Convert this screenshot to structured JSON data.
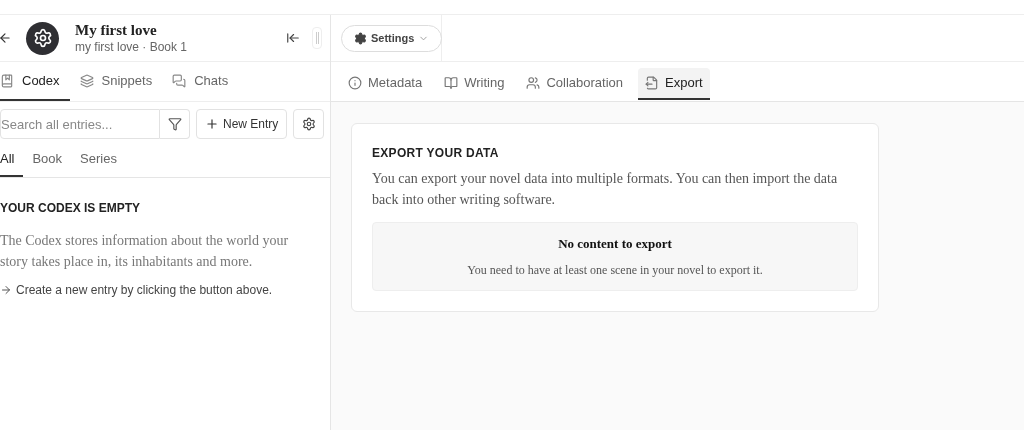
{
  "project": {
    "title": "My first love",
    "subtitle": "my first love · Book 1"
  },
  "settings_button": {
    "label": "Settings"
  },
  "sidebar_tabs": [
    {
      "label": "Codex",
      "selected": true
    },
    {
      "label": "Snippets",
      "selected": false
    },
    {
      "label": "Chats",
      "selected": false
    }
  ],
  "search": {
    "placeholder": "Search all entries..."
  },
  "new_entry_button": {
    "label": "New Entry"
  },
  "filter_tabs": [
    {
      "label": "All",
      "selected": true
    },
    {
      "label": "Book",
      "selected": false
    },
    {
      "label": "Series",
      "selected": false
    }
  ],
  "codex_empty": {
    "heading": "YOUR CODEX IS EMPTY",
    "text": "The Codex stores information about the world your story takes place in, its inhabitants and more.",
    "hint": "Create a new entry by clicking the button above."
  },
  "main_tabs": [
    {
      "label": "Metadata",
      "selected": false
    },
    {
      "label": "Writing",
      "selected": false
    },
    {
      "label": "Collaboration",
      "selected": false
    },
    {
      "label": "Export",
      "selected": true
    }
  ],
  "export_card": {
    "heading": "EXPORT YOUR DATA",
    "text": "You can export your novel data into multiple formats. You can then import the data back into other writing software.",
    "notice_title": "No content to export",
    "notice_text": "You need to have at least one scene in your novel to export it."
  }
}
